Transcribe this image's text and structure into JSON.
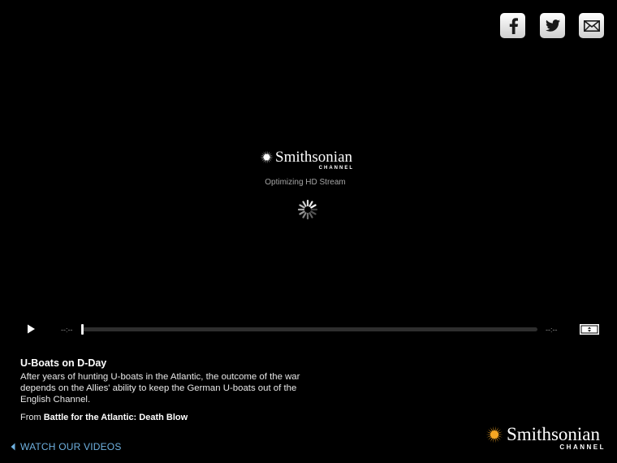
{
  "social": {
    "facebook_icon": "facebook-icon",
    "twitter_icon": "twitter-icon",
    "email_icon": "email-icon"
  },
  "loader": {
    "logo_word": "Smithsonian",
    "logo_sub": "CHANNEL",
    "status": "Optimizing HD Stream"
  },
  "controls": {
    "time_current": "--:--",
    "time_total": "--:--",
    "progress": 0
  },
  "video": {
    "title": "U-Boats on D-Day",
    "description": "After years of hunting U-boats in the Atlantic, the outcome of the war depends on the Allies' ability to keep the German U-boats out of the English Channel.",
    "from_prefix": "From",
    "from_show": "Battle for the Atlantic: Death Blow"
  },
  "footer": {
    "watch_label": "WATCH OUR VIDEOS",
    "logo_word": "Smithsonian",
    "logo_sub": "CHANNEL"
  },
  "colors": {
    "background": "#000000",
    "link": "#6fb1e0",
    "sun": "#f5a623"
  }
}
